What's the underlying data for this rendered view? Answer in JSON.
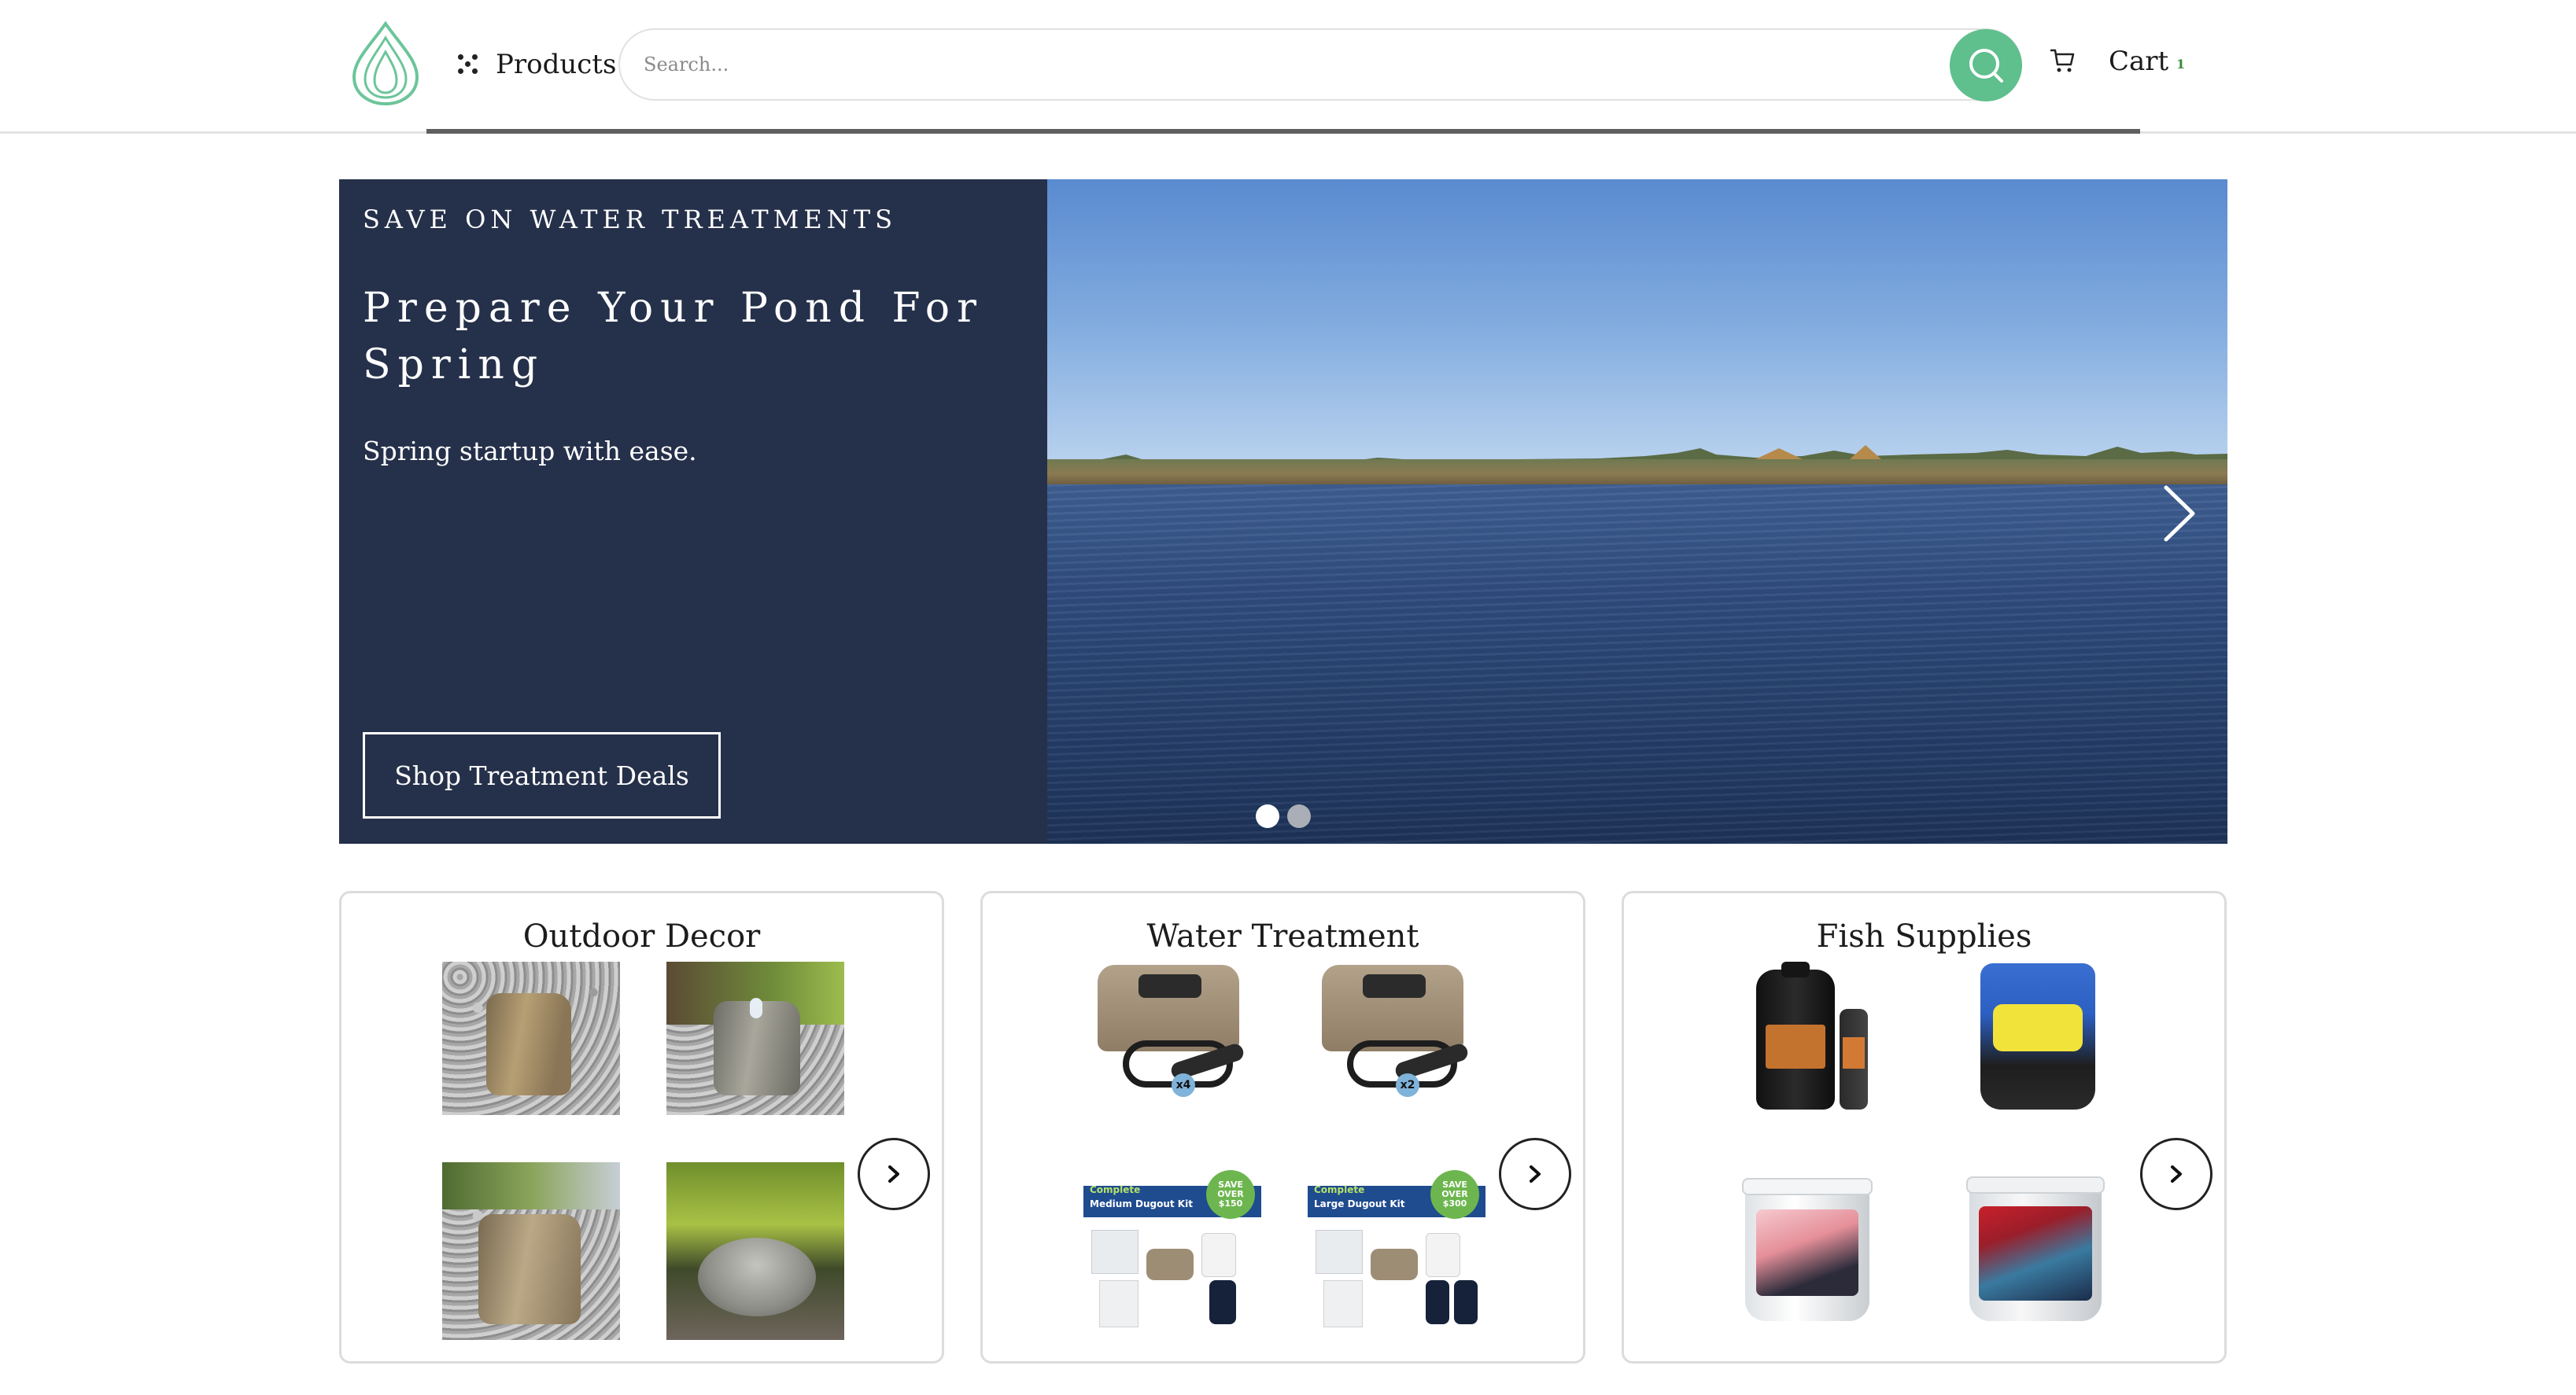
{
  "header": {
    "products_label": "Products",
    "search_placeholder": "Search...",
    "cart_label": "Cart",
    "cart_count": "1"
  },
  "hero": {
    "eyebrow": "SAVE ON WATER TREATMENTS",
    "title": "Prepare Your Pond For Spring",
    "subtitle": "Spring startup with ease.",
    "cta_label": "Shop Treatment Deals",
    "slide_count": 2,
    "active_slide": 1
  },
  "categories": [
    {
      "title": "Outdoor Decor"
    },
    {
      "title": "Water Treatment"
    },
    {
      "title": "Fish Supplies"
    }
  ],
  "water_treatment_thumbs": {
    "kit_a_badge_count": "x4",
    "kit_b_badge_count": "x2",
    "kit_c_tag": "Complete",
    "kit_c_name": "Medium Dugout Kit",
    "kit_c_save": "SAVE OVER $150",
    "kit_d_tag": "Complete",
    "kit_d_name": "Large Dugout Kit",
    "kit_d_save": "SAVE OVER $300"
  },
  "colors": {
    "brand_green": "#5fbf8d",
    "hero_panel": "#25304a"
  }
}
